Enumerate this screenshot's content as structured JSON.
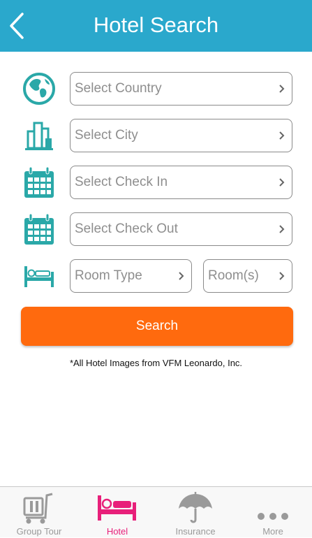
{
  "header": {
    "title": "Hotel Search",
    "back_icon": "chevron-left-icon",
    "background_color": "#2aa8cc"
  },
  "form": {
    "country": {
      "placeholder": "Select Country",
      "icon": "globe-icon"
    },
    "city": {
      "placeholder": "Select City",
      "icon": "city-buildings-icon"
    },
    "check_in": {
      "placeholder": "Select Check In",
      "icon": "calendar-icon"
    },
    "check_out": {
      "placeholder": "Select Check Out",
      "icon": "calendar-icon"
    },
    "room_type": {
      "placeholder": "Room Type",
      "icon": "bed-icon"
    },
    "rooms": {
      "placeholder": "Room(s)"
    },
    "icon_color": "#2aa8a8"
  },
  "search_button": {
    "label": "Search",
    "color": "#ff6a0e"
  },
  "footnote": "*All Hotel Images from VFM Leonardo, Inc.",
  "tabbar": {
    "active_color": "#e8207a",
    "inactive_color": "#9a9a9a",
    "tabs": [
      {
        "label": "Group Tour",
        "icon": "luggage-cart-icon",
        "active": false
      },
      {
        "label": "Hotel",
        "icon": "bed-icon",
        "active": true
      },
      {
        "label": "Insurance",
        "icon": "umbrella-icon",
        "active": false
      },
      {
        "label": "More",
        "icon": "more-dots-icon",
        "active": false
      }
    ]
  }
}
